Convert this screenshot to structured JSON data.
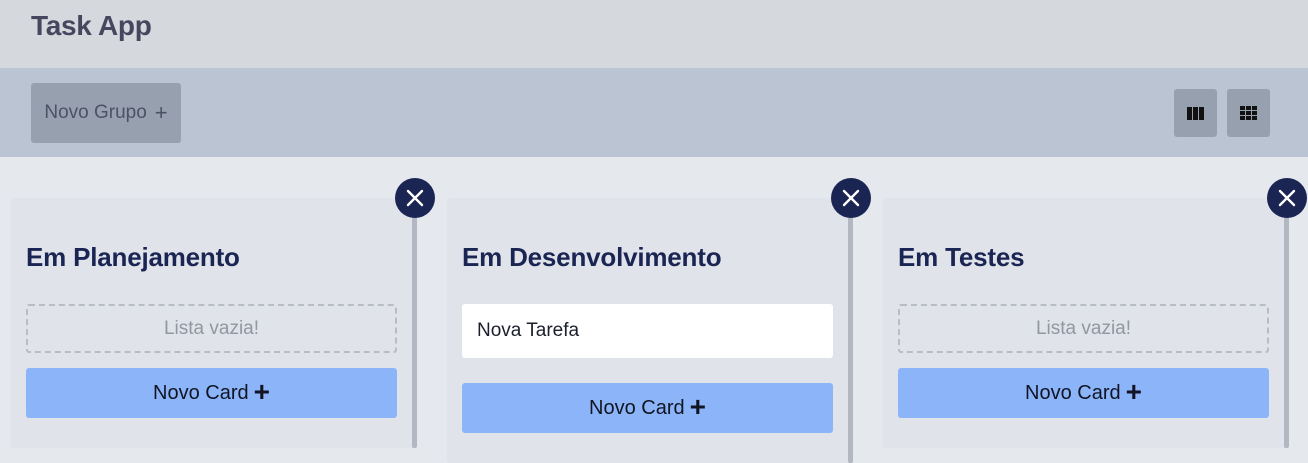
{
  "app": {
    "title": "Task App"
  },
  "toolbar": {
    "new_group_label": "Novo Grupo",
    "new_group_icon": "plus-icon",
    "view_columns_icon": "columns-view-icon",
    "view_grid_icon": "grid-view-icon"
  },
  "columns": [
    {
      "title": "Em Planejamento",
      "empty_text": "Lista vazia!",
      "cards": [],
      "new_card_label": "Novo Card"
    },
    {
      "title": "Em Desenvolvimento",
      "cards": [
        {
          "text": "Nova Tarefa"
        }
      ],
      "new_card_label": "Novo Card"
    },
    {
      "title": "Em Testes",
      "empty_text": "Lista vazia!",
      "cards": [],
      "new_card_label": "Novo Card"
    }
  ],
  "colors": {
    "accent_dark": "#1b2553",
    "new_card_button": "#8bb5f8",
    "toolbar": "#bac4d2",
    "header": "#d5d9de"
  }
}
